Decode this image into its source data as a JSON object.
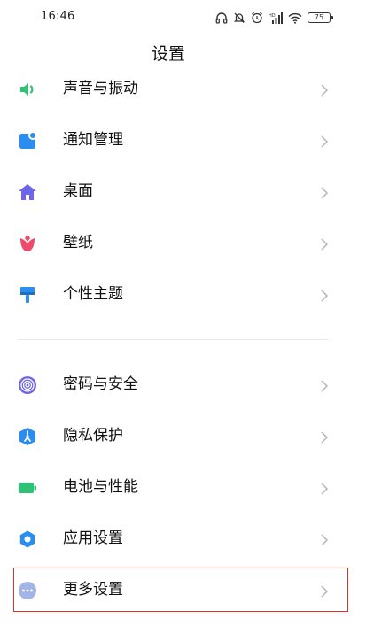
{
  "status_bar": {
    "time": "16:46",
    "battery_level": "75",
    "icons": [
      "headphones-icon",
      "notifications-off-icon",
      "alarm-icon",
      "signal-icon",
      "wifi-icon",
      "battery-icon"
    ]
  },
  "header": {
    "title": "设置"
  },
  "settings": {
    "group1": [
      {
        "label": "声音与振动",
        "icon": "speaker-icon",
        "color": "#2fc274"
      },
      {
        "label": "通知管理",
        "icon": "notification-icon",
        "color": "#2c8df0"
      },
      {
        "label": "桌面",
        "icon": "home-icon",
        "color": "#6f65e8"
      },
      {
        "label": "壁纸",
        "icon": "flower-icon",
        "color": "#ef4a6b"
      },
      {
        "label": "个性主题",
        "icon": "paintbrush-icon",
        "color": "#2c8df0"
      }
    ],
    "group2": [
      {
        "label": "密码与安全",
        "icon": "fingerprint-icon",
        "color": "#6f65e8"
      },
      {
        "label": "隐私保护",
        "icon": "privacy-shield-icon",
        "color": "#2c8df0"
      },
      {
        "label": "电池与性能",
        "icon": "battery-performance-icon",
        "color": "#2fc274"
      },
      {
        "label": "应用设置",
        "icon": "gear-icon",
        "color": "#2c8df0"
      },
      {
        "label": "更多设置",
        "icon": "more-dots-icon",
        "color": "#a3b5e6"
      }
    ]
  },
  "highlight_color": "#d9342b"
}
